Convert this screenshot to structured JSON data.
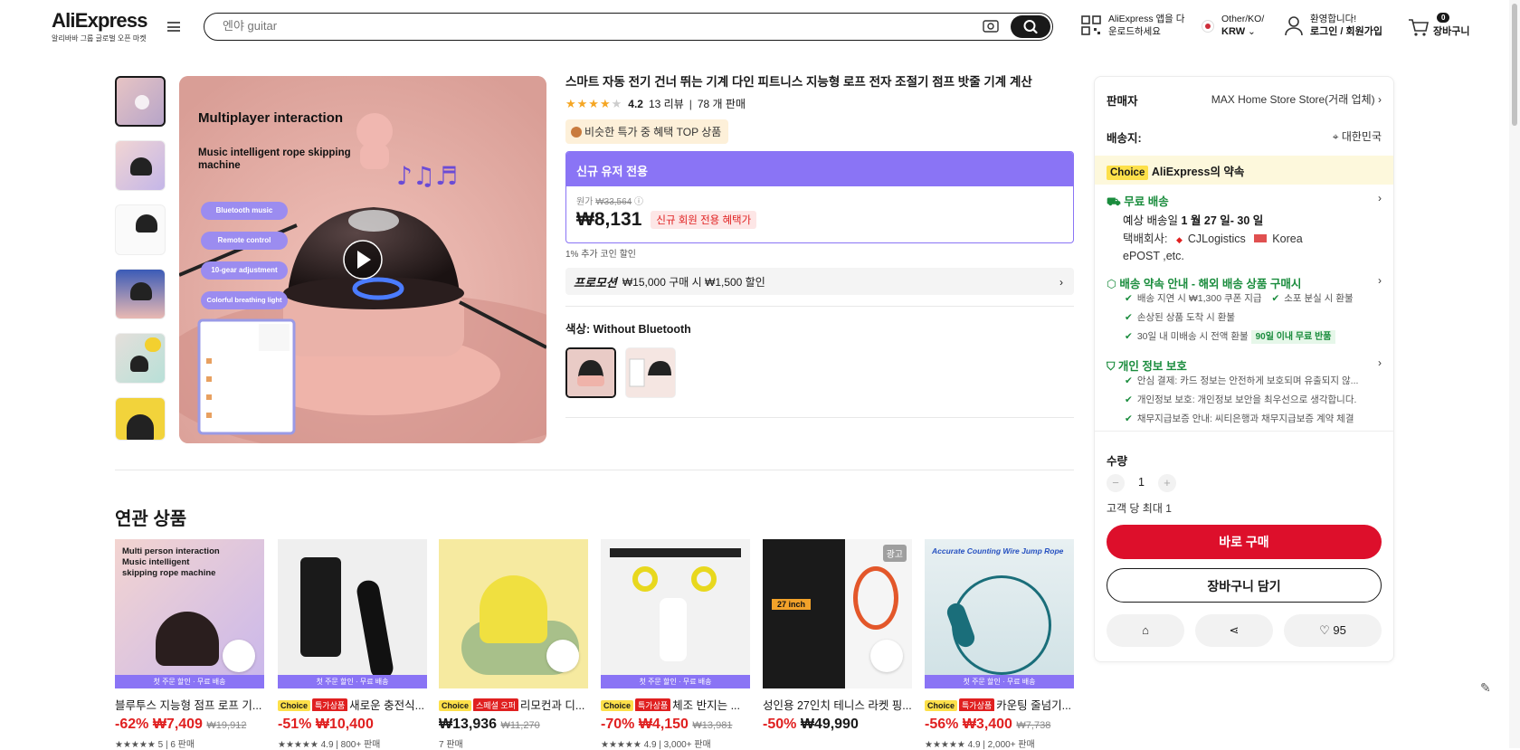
{
  "header": {
    "logo": "AliExpress",
    "logo_sub": "알리바바 그룹 글로벌 오픈 마켓",
    "search_placeholder": "엔야 guitar",
    "app_line1": "AliExpress 앱을 다",
    "app_line2": "운로드하세요",
    "locale_line1": "Other/KO/",
    "locale_currency": "KRW",
    "account_line1": "환영합니다!",
    "account_line2": "로그인 / 회원가입",
    "cart_label": "장바구니",
    "cart_count": "0"
  },
  "gallery": {
    "headline": "Multiplayer interaction",
    "sub1": "Music intelligent rope skipping",
    "sub2": "machine",
    "pills": [
      "Bluetooth music",
      "Remote control",
      "10-gear adjustment",
      "Colorful breathing light"
    ]
  },
  "product": {
    "title": "스마트 자동 전기 건너 뛰는 기계 다인 피트니스 지능형 로프 전자 조절기 점프 밧줄 기계 계산",
    "rating": "4.2",
    "reviews": "13 리뷰",
    "sold": "78 개 판매",
    "top_badge": "비슷한 특가 중 혜택 TOP 상품",
    "newuser_header": "신규 유저 전용",
    "orig_label": "원가",
    "orig_price": "₩33,564",
    "price": "₩8,131",
    "price_tag": "신규 회원 전용 혜택가",
    "coin_note": "1% 추가 코인 할인",
    "promo_label": "프로모션",
    "promo_text": "₩15,000 구매 시 ₩1,500 할인",
    "color_label": "색상: Without Bluetooth"
  },
  "panel": {
    "seller_label": "판매자",
    "seller_value": "MAX Home Store Store(거래 업체)",
    "ship_label": "배송지:",
    "ship_value": "대한민국",
    "choice_tag": "Choice",
    "promise": "AliExpress의 약속",
    "free_ship": "무료 배송",
    "eta_prefix": "예상 배송일",
    "eta": "1 월 27 일- 30 일",
    "carrier_label": "택배회사:",
    "carrier1": "CJLogistics",
    "carrier2": "Korea",
    "carrier3": "ePOST ,etc.",
    "guide_title": "배송 약속 안내 - 해외 배송 상품 구매시",
    "guide_items": [
      "배송 지연 시 ₩1,300 쿠폰 지급",
      "소포 분실 시 환불",
      "손상된 상품 도착 시 환불",
      "30일 내 미배송 시 전액 환불"
    ],
    "guide_tag": "90일 이내 무료 반품",
    "privacy_title": "개인 정보 보호",
    "privacy_items": [
      "안심 결제: 카드 정보는 안전하게 보호되며 유출되지 않...",
      "개인정보 보호: 개인정보 보안을 최우선으로 생각합니다.",
      "채무지급보증 안내: 씨티은행과 채무지급보증 계약 체결"
    ],
    "qty_label": "수량",
    "qty_value": "1",
    "qty_limit": "고객 당 최대 1",
    "buy_now": "바로 구매",
    "add_cart": "장바구니 담기",
    "wish_count": "95"
  },
  "related": {
    "title": "연관 상품",
    "cards": [
      {
        "img_text": "Multi person interaction Music intelligent skipping rope machine",
        "bar": "첫 주문 할인 · 무료 배송",
        "title": "블루투스 지능형 점프 로프 기...",
        "discount": "-62%",
        "price": "₩7,409",
        "orig": "₩19,912",
        "meta": "5 | 6 판매"
      },
      {
        "bar": "첫 주문 할인 · 무료 배송",
        "tag1": "Choice",
        "tag2": "특가상품",
        "title": "새로운 충전식...",
        "discount": "-51%",
        "price": "₩10,400",
        "orig": "",
        "meta": "4.9 | 800+ 판매"
      },
      {
        "tag1": "Choice",
        "tag2": "스페셜 오퍼",
        "title": "리모컨과 디...",
        "discount": "",
        "price": "₩13,936",
        "orig": "₩11,270",
        "meta": "7 판매"
      },
      {
        "bar": "첫 주문 할인 · 무료 배송",
        "tag1": "Choice",
        "tag2": "특가상품",
        "title": "체조 반지는 ...",
        "discount": "-70%",
        "price": "₩4,150",
        "orig": "₩13,981",
        "meta": "4.9 | 3,000+ 판매"
      },
      {
        "ad": "광고",
        "img_text": "27 inch",
        "title": "성인용 27인치 테니스 라켓 핑...",
        "discount": "-50%",
        "price": "₩49,990",
        "orig": "",
        "meta": ""
      },
      {
        "img_text": "Accurate Counting Wire Jump Rope",
        "bar": "첫 주문 할인 · 무료 배송",
        "tag1": "Choice",
        "tag2": "특가상품",
        "title": "카운팅 줄넘기...",
        "discount": "-56%",
        "price": "₩3,400",
        "orig": "₩7,738",
        "meta": "4.9 | 2,000+ 판매"
      }
    ]
  },
  "colors": {
    "accent": "#e02020",
    "purple": "#8a74f5",
    "choice": "#fde04a",
    "green": "#1a8c3d",
    "buy": "#dd0f2b"
  }
}
